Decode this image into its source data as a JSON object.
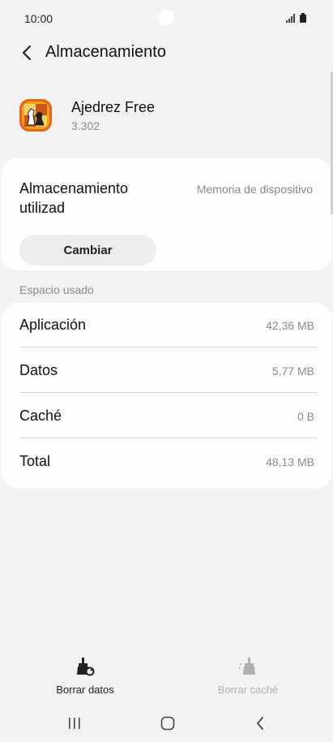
{
  "status_bar": {
    "time": "10:00"
  },
  "header": {
    "title": "Almacenamiento",
    "back_icon": "chevron-left-icon"
  },
  "app": {
    "name": "Ajedrez Free",
    "version": "3.302",
    "icon": "chess-app-icon"
  },
  "storage": {
    "label": "Almacenamiento utilizad",
    "value": "Memoria de dispositivo",
    "change_label": "Cambiar"
  },
  "usage": {
    "section_title": "Espacio usado",
    "rows": [
      {
        "label": "Aplicación",
        "value": "42,36 MB"
      },
      {
        "label": "Datos",
        "value": "5,77 MB"
      },
      {
        "label": "Caché",
        "value": "0 B"
      },
      {
        "label": "Total",
        "value": "48,13 MB"
      }
    ]
  },
  "actions": {
    "clear_data": {
      "label": "Borrar datos",
      "icon": "broom-icon"
    },
    "clear_cache": {
      "label": "Borrar caché",
      "icon": "broom-sparkle-icon"
    }
  },
  "nav": {
    "recent": "recent-apps-icon",
    "home": "home-icon",
    "back": "back-icon"
  },
  "colors": {
    "background": "#f2f2f2",
    "card": "#fdfdfd",
    "secondary_text": "#8a8a8a",
    "disabled_text": "#b0b0b0"
  }
}
